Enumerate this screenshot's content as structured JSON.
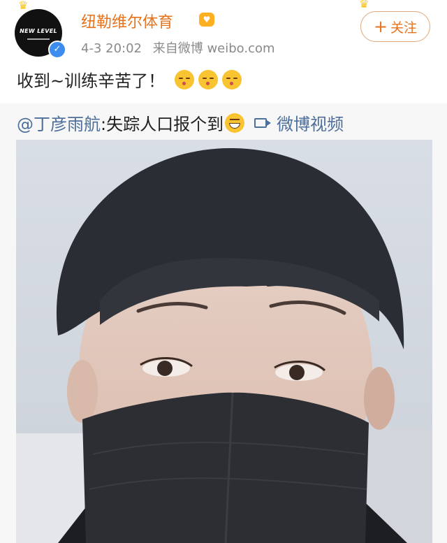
{
  "user": {
    "name": "纽勒维尔体育",
    "avatar_text": "NEW LEVEL",
    "timestamp": "4-3 20:02",
    "source": "来自微博 weibo.com"
  },
  "follow_button": {
    "label": "关注",
    "icon": "plus-icon"
  },
  "post": {
    "text": "收到~训练辛苦了！",
    "emojis": [
      "kiss-emoji",
      "kiss-emoji",
      "kiss-emoji"
    ]
  },
  "repost": {
    "mention": "@丁彦雨航",
    "text": ":失踪人口报个到",
    "emoji": "grin-emoji",
    "video_label": "微博视频"
  },
  "colors": {
    "username": "#e8731c",
    "link": "#4d6f9c",
    "meta": "#8a8a8a",
    "repost_bg": "#f7f7f7",
    "verified": "#3d8cf0"
  }
}
